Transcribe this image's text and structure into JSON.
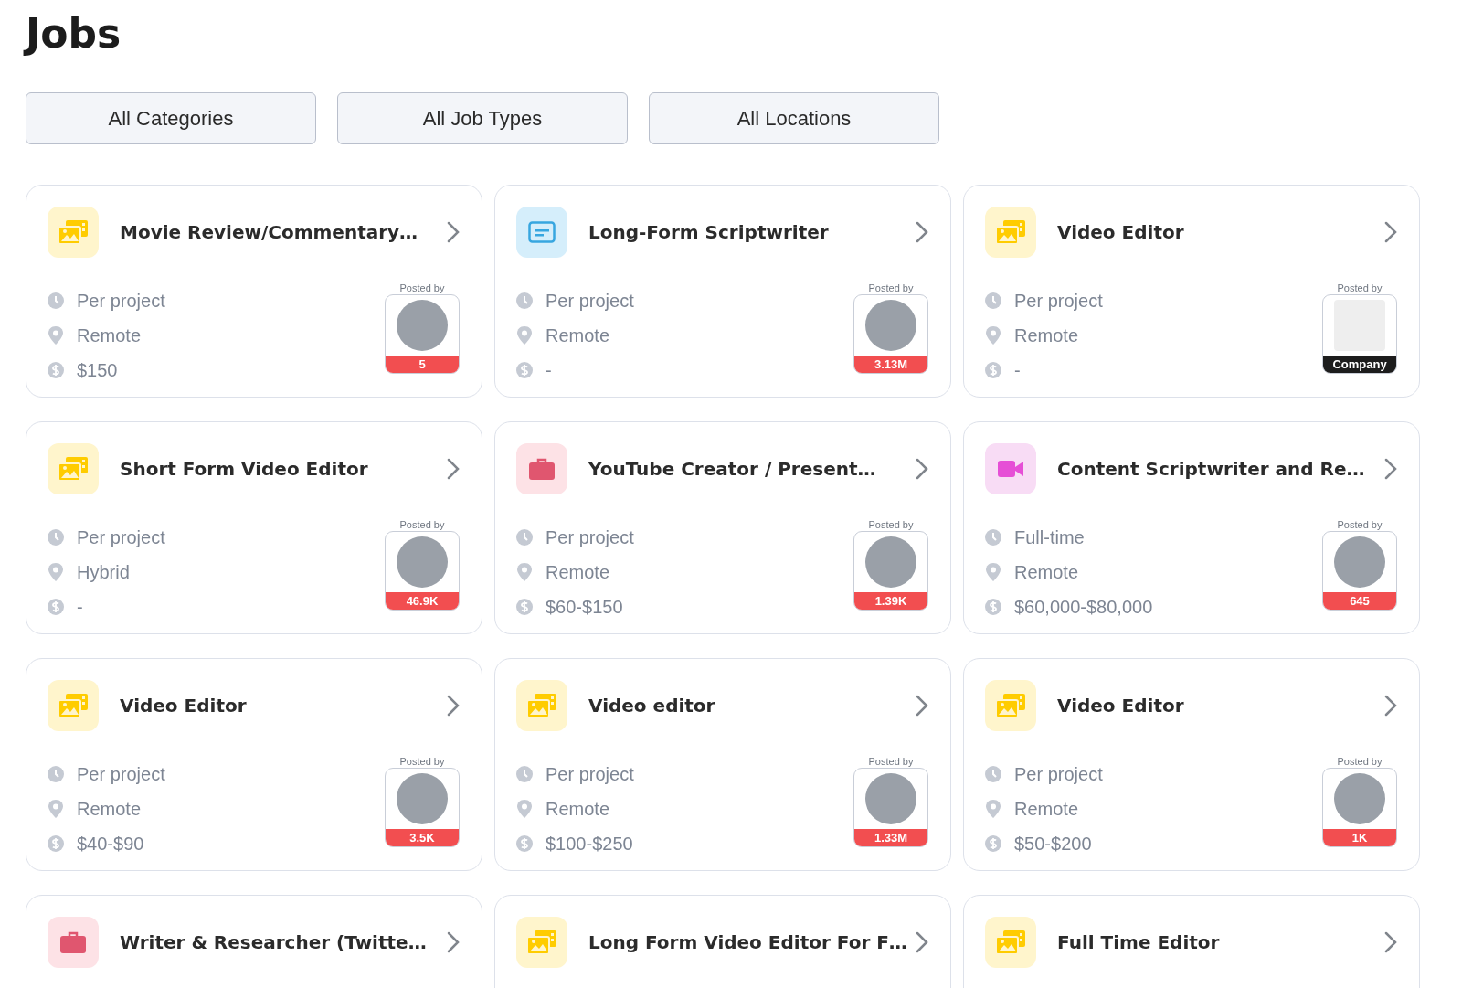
{
  "title": "Jobs",
  "filters": [
    "All Categories",
    "All Job Types",
    "All Locations"
  ],
  "jobs": [
    {
      "kind": "media",
      "title": "Movie Review/Commentary…",
      "details": {
        "type": "Per project",
        "location": "Remote",
        "pay": "$150"
      },
      "poster": {
        "label": "Posted by",
        "kind": "count",
        "text": "5"
      }
    },
    {
      "kind": "text",
      "title": "Long-Form Scriptwriter",
      "details": {
        "type": "Per project",
        "location": "Remote",
        "pay": "-"
      },
      "poster": {
        "label": "Posted by",
        "kind": "count",
        "text": "3.13M"
      }
    },
    {
      "kind": "media",
      "title": "Video Editor",
      "details": {
        "type": "Per project",
        "location": "Remote",
        "pay": "-"
      },
      "poster": {
        "label": "Posted by",
        "kind": "company",
        "text": "Company"
      }
    },
    {
      "kind": "media",
      "title": "Short Form Video Editor",
      "details": {
        "type": "Per project",
        "location": "Hybrid",
        "pay": "-"
      },
      "poster": {
        "label": "Posted by",
        "kind": "count",
        "text": "46.9K"
      }
    },
    {
      "kind": "briefcase",
      "title": "YouTube Creator / Present…",
      "details": {
        "type": "Per project",
        "location": "Remote",
        "pay": "$60-$150"
      },
      "poster": {
        "label": "Posted by",
        "kind": "count",
        "text": "1.39K"
      }
    },
    {
      "kind": "video",
      "title": "Content Scriptwriter and Re…",
      "details": {
        "type": "Full-time",
        "location": "Remote",
        "pay": "$60,000-$80,000"
      },
      "poster": {
        "label": "Posted by",
        "kind": "count",
        "text": "645"
      }
    },
    {
      "kind": "media",
      "title": "Video Editor",
      "details": {
        "type": "Per project",
        "location": "Remote",
        "pay": "$40-$90"
      },
      "poster": {
        "label": "Posted by",
        "kind": "count",
        "text": "3.5K"
      }
    },
    {
      "kind": "media",
      "title": "Video editor",
      "details": {
        "type": "Per project",
        "location": "Remote",
        "pay": "$100-$250"
      },
      "poster": {
        "label": "Posted by",
        "kind": "count",
        "text": "1.33M"
      }
    },
    {
      "kind": "media",
      "title": "Video Editor",
      "details": {
        "type": "Per project",
        "location": "Remote",
        "pay": "$50-$200"
      },
      "poster": {
        "label": "Posted by",
        "kind": "count",
        "text": "1K"
      }
    },
    {
      "kind": "briefcase",
      "title": "Writer & Researcher (Twitte…"
    },
    {
      "kind": "media",
      "title": "Long Form Video Editor For F…"
    },
    {
      "kind": "media",
      "title": "Full Time Editor"
    }
  ]
}
